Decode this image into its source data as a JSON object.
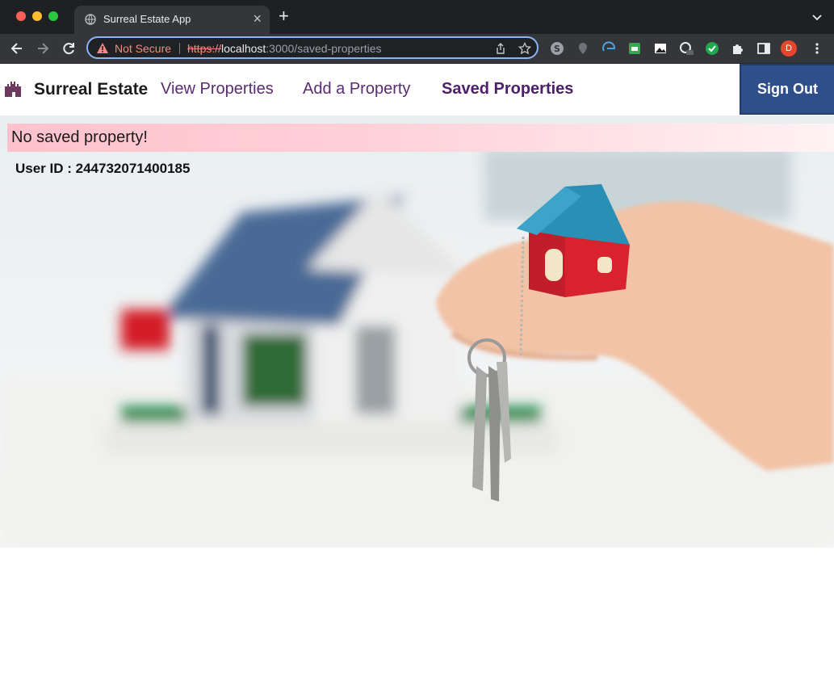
{
  "browser": {
    "tab_title": "Surreal Estate App",
    "security_label": "Not Secure",
    "url_scheme": "https://",
    "url_host": "localhost",
    "url_rest": ":3000/saved-properties",
    "profile_initial": "D"
  },
  "app": {
    "brand": "Surreal Estate",
    "nav": {
      "view_properties": "View Properties",
      "add_property": "Add a Property",
      "saved_properties": "Saved Properties"
    },
    "sign_out": "Sign Out",
    "alert_message": "No saved property!",
    "user_id_text": "User ID : 244732071400185"
  },
  "icons": {
    "brand": "castle-icon",
    "hero": "house-with-keys-image"
  },
  "colors": {
    "nav_link": "#5a2b73",
    "sign_out_bg": "#2f4f8a",
    "alert_bg": "#ffc2cc"
  }
}
